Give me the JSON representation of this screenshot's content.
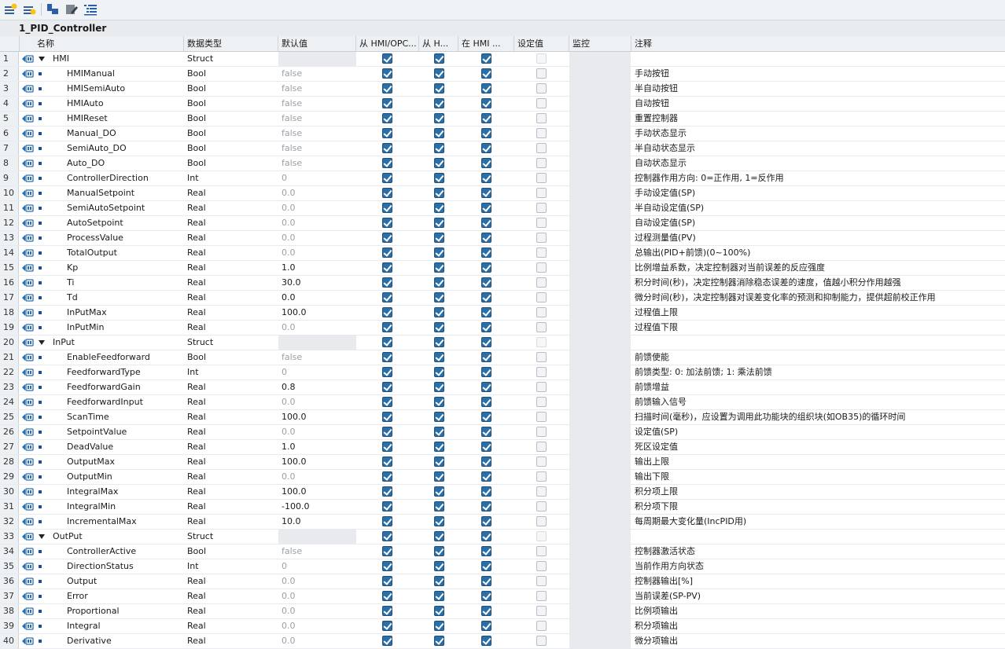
{
  "block_title": "1_PID_Controller",
  "toolbar": {
    "icons": [
      "insert-row-icon",
      "add-row-icon",
      "expand-icon",
      "edit-icon",
      "tree-list-icon"
    ]
  },
  "columns": {
    "name": "名称",
    "datatype": "数据类型",
    "default": "默认值",
    "hmi_opc": "从 HMI/OPC...",
    "hmi_visible": "从 H...",
    "hmi_setpoint": "在 HMI ...",
    "setpoint": "设定值",
    "monitor": "监控",
    "comment": "注释"
  },
  "colors": {
    "checkbox_on": "#2b6fa8",
    "row_num_bg": "#eef1f4",
    "grid_line": "#e7eaee"
  },
  "rows": [
    {
      "num": "1",
      "name": "HMI",
      "type": "Struct",
      "default": "",
      "level": 0,
      "struct": true,
      "comment": ""
    },
    {
      "num": "2",
      "name": "HMIManual",
      "type": "Bool",
      "default": "false",
      "level": 1,
      "dim": true,
      "comment": "手动按钮"
    },
    {
      "num": "3",
      "name": "HMISemiAuto",
      "type": "Bool",
      "default": "false",
      "level": 1,
      "dim": true,
      "comment": "半自动按钮"
    },
    {
      "num": "4",
      "name": "HMIAuto",
      "type": "Bool",
      "default": "false",
      "level": 1,
      "dim": true,
      "comment": "自动按钮"
    },
    {
      "num": "5",
      "name": "HMIReset",
      "type": "Bool",
      "default": "false",
      "level": 1,
      "dim": true,
      "comment": "重置控制器"
    },
    {
      "num": "6",
      "name": "Manual_DO",
      "type": "Bool",
      "default": "false",
      "level": 1,
      "dim": true,
      "comment": "手动状态显示"
    },
    {
      "num": "7",
      "name": "SemiAuto_DO",
      "type": "Bool",
      "default": "false",
      "level": 1,
      "dim": true,
      "comment": "半自动状态显示"
    },
    {
      "num": "8",
      "name": "Auto_DO",
      "type": "Bool",
      "default": "false",
      "level": 1,
      "dim": true,
      "comment": "自动状态显示"
    },
    {
      "num": "9",
      "name": "ControllerDirection",
      "type": "Int",
      "default": "0",
      "level": 1,
      "dim": true,
      "comment": "控制器作用方向: 0=正作用, 1=反作用"
    },
    {
      "num": "10",
      "name": "ManualSetpoint",
      "type": "Real",
      "default": "0.0",
      "level": 1,
      "dim": true,
      "comment": "手动设定值(SP)"
    },
    {
      "num": "11",
      "name": "SemiAutoSetpoint",
      "type": "Real",
      "default": "0.0",
      "level": 1,
      "dim": true,
      "comment": "半自动设定值(SP)"
    },
    {
      "num": "12",
      "name": "AutoSetpoint",
      "type": "Real",
      "default": "0.0",
      "level": 1,
      "dim": true,
      "comment": "自动设定值(SP)"
    },
    {
      "num": "13",
      "name": "ProcessValue",
      "type": "Real",
      "default": "0.0",
      "level": 1,
      "dim": true,
      "comment": "过程测量值(PV)"
    },
    {
      "num": "14",
      "name": "TotalOutput",
      "type": "Real",
      "default": "0.0",
      "level": 1,
      "dim": true,
      "comment": "总输出(PID+前馈)(0~100%)"
    },
    {
      "num": "15",
      "name": "Kp",
      "type": "Real",
      "default": "1.0",
      "level": 1,
      "dim": false,
      "comment": "比例增益系数，决定控制器对当前误差的反应强度"
    },
    {
      "num": "16",
      "name": "Ti",
      "type": "Real",
      "default": "30.0",
      "level": 1,
      "dim": false,
      "comment": "积分时间(秒)，决定控制器消除稳态误差的速度，值越小积分作用越强"
    },
    {
      "num": "17",
      "name": "Td",
      "type": "Real",
      "default": "0.0",
      "level": 1,
      "dim": false,
      "comment": "微分时间(秒)，决定控制器对误差变化率的预测和抑制能力，提供超前校正作用"
    },
    {
      "num": "18",
      "name": "InPutMax",
      "type": "Real",
      "default": "100.0",
      "level": 1,
      "dim": false,
      "comment": "过程值上限"
    },
    {
      "num": "19",
      "name": "InPutMin",
      "type": "Real",
      "default": "0.0",
      "level": 1,
      "dim": true,
      "comment": "过程值下限"
    },
    {
      "num": "20",
      "name": "InPut",
      "type": "Struct",
      "default": "",
      "level": 0,
      "struct": true,
      "comment": ""
    },
    {
      "num": "21",
      "name": "EnableFeedforward",
      "type": "Bool",
      "default": "false",
      "level": 1,
      "dim": true,
      "comment": "前馈使能"
    },
    {
      "num": "22",
      "name": "FeedforwardType",
      "type": "Int",
      "default": "0",
      "level": 1,
      "dim": true,
      "comment": "前馈类型: 0: 加法前馈; 1: 乘法前馈"
    },
    {
      "num": "23",
      "name": "FeedforwardGain",
      "type": "Real",
      "default": "0.8",
      "level": 1,
      "dim": false,
      "comment": "前馈增益"
    },
    {
      "num": "24",
      "name": "FeedforwardInput",
      "type": "Real",
      "default": "0.0",
      "level": 1,
      "dim": true,
      "comment": "前馈输入信号"
    },
    {
      "num": "25",
      "name": "ScanTime",
      "type": "Real",
      "default": "100.0",
      "level": 1,
      "dim": false,
      "comment": "扫描时间(毫秒)，应设置为调用此功能块的组织块(如OB35)的循环时间"
    },
    {
      "num": "26",
      "name": "SetpointValue",
      "type": "Real",
      "default": "0.0",
      "level": 1,
      "dim": true,
      "comment": "设定值(SP)"
    },
    {
      "num": "27",
      "name": "DeadValue",
      "type": "Real",
      "default": "1.0",
      "level": 1,
      "dim": false,
      "comment": "死区设定值"
    },
    {
      "num": "28",
      "name": "OutputMax",
      "type": "Real",
      "default": "100.0",
      "level": 1,
      "dim": false,
      "comment": "输出上限"
    },
    {
      "num": "29",
      "name": "OutputMin",
      "type": "Real",
      "default": "0.0",
      "level": 1,
      "dim": true,
      "comment": "输出下限"
    },
    {
      "num": "30",
      "name": "IntegralMax",
      "type": "Real",
      "default": "100.0",
      "level": 1,
      "dim": false,
      "comment": "积分项上限"
    },
    {
      "num": "31",
      "name": "IntegralMin",
      "type": "Real",
      "default": "-100.0",
      "level": 1,
      "dim": false,
      "comment": "积分项下限"
    },
    {
      "num": "32",
      "name": "IncrementalMax",
      "type": "Real",
      "default": "10.0",
      "level": 1,
      "dim": false,
      "comment": "每周期最大变化量(IncPID用)"
    },
    {
      "num": "33",
      "name": "OutPut",
      "type": "Struct",
      "default": "",
      "level": 0,
      "struct": true,
      "comment": ""
    },
    {
      "num": "34",
      "name": "ControllerActive",
      "type": "Bool",
      "default": "false",
      "level": 1,
      "dim": true,
      "comment": "控制器激活状态"
    },
    {
      "num": "35",
      "name": "DirectionStatus",
      "type": "Int",
      "default": "0",
      "level": 1,
      "dim": true,
      "comment": "当前作用方向状态"
    },
    {
      "num": "36",
      "name": "Output",
      "type": "Real",
      "default": "0.0",
      "level": 1,
      "dim": true,
      "comment": "控制器输出[%]"
    },
    {
      "num": "37",
      "name": "Error",
      "type": "Real",
      "default": "0.0",
      "level": 1,
      "dim": true,
      "comment": "当前误差(SP-PV)"
    },
    {
      "num": "38",
      "name": "Proportional",
      "type": "Real",
      "default": "0.0",
      "level": 1,
      "dim": true,
      "comment": "比例项输出"
    },
    {
      "num": "39",
      "name": "Integral",
      "type": "Real",
      "default": "0.0",
      "level": 1,
      "dim": true,
      "comment": "积分项输出"
    },
    {
      "num": "40",
      "name": "Derivative",
      "type": "Real",
      "default": "0.0",
      "level": 1,
      "dim": true,
      "comment": "微分项输出"
    }
  ]
}
